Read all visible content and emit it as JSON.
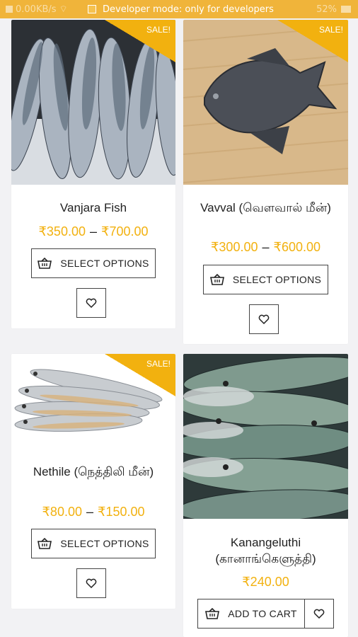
{
  "status_bar": {
    "speed": "0.00KB/s",
    "developer_message": "Developer mode: only for developers",
    "battery": "52%"
  },
  "colors": {
    "accent": "#f2b10f",
    "price": "#f2b10f",
    "text": "#222222"
  },
  "products": [
    {
      "name": "Vanjara Fish",
      "badge": "SALE!",
      "price_low": "₹350.00",
      "price_sep": "–",
      "price_high": "₹700.00",
      "action_label": "SELECT OPTIONS",
      "action_icon": "basket-icon",
      "wishlist_icon": "heart-icon"
    },
    {
      "name": "Vavval (வௌவால் மீன்)",
      "badge": "SALE!",
      "price_low": "₹300.00",
      "price_sep": "–",
      "price_high": "₹600.00",
      "action_label": "SELECT OPTIONS",
      "action_icon": "basket-icon",
      "wishlist_icon": "heart-icon"
    },
    {
      "name": "Nethile (நெத்திலி மீன்)",
      "badge": "SALE!",
      "price_low": "₹80.00",
      "price_sep": "–",
      "price_high": "₹150.00",
      "action_label": "SELECT OPTIONS",
      "action_icon": "basket-icon",
      "wishlist_icon": "heart-icon"
    },
    {
      "name": "Kanangeluthi (கானாங்கெளுத்தி)",
      "price": "₹240.00",
      "action_label": "ADD TO CART",
      "action_icon": "basket-icon",
      "wishlist_icon": "heart-icon"
    }
  ]
}
